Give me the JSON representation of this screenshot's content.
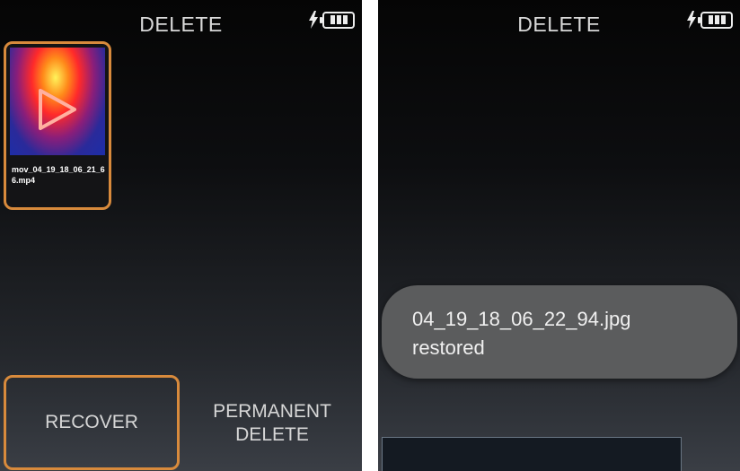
{
  "left_screen": {
    "title": "DELETE",
    "icons": {
      "charging": "lightning-icon",
      "battery": "battery-icon"
    },
    "thumbnail": {
      "caption": "mov_04_19_18_06_21_66.mp4",
      "icon": "play-icon"
    },
    "buttons": {
      "recover": "RECOVER",
      "permanent_delete": "PERMANENT DELETE"
    }
  },
  "right_screen": {
    "title": "DELETE",
    "icons": {
      "charging": "lightning-icon",
      "battery": "battery-icon"
    },
    "toast": {
      "filename": "04_19_18_06_22_94.jpg",
      "status": "restored"
    }
  },
  "colors": {
    "accent": "#d88a3c",
    "toast_bg": "#5b5c5d",
    "text": "#d9d9d9"
  }
}
